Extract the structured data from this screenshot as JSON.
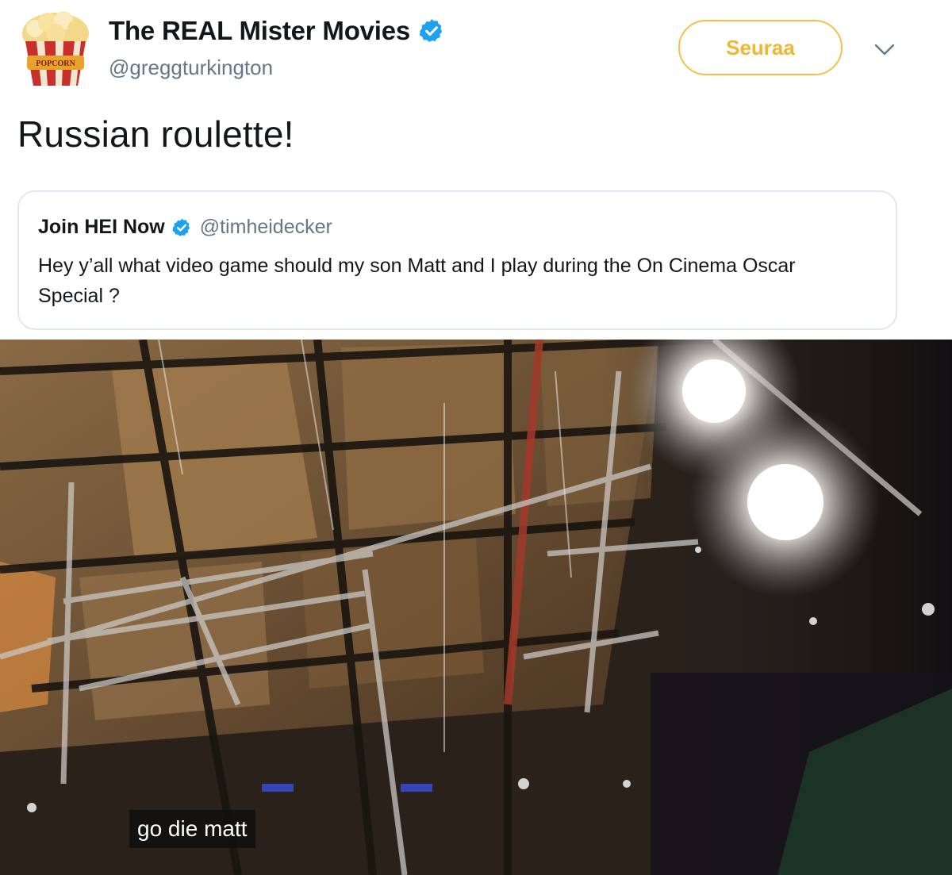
{
  "tweet": {
    "display_name": "The REAL Mister Movies",
    "handle": "@greggturkington",
    "follow_label": "Seuraa",
    "text": "Russian roulette!",
    "avatar_text": "POPCORN"
  },
  "quoted_tweet": {
    "display_name": "Join HEI Now",
    "handle": "@timheidecker",
    "text": "Hey y’all what video game should my son Matt and I play during the On Cinema Oscar Special ?"
  },
  "video": {
    "caption": "go die matt"
  },
  "colors": {
    "verified": "#1da1f2",
    "follow_accent": "#f2b534",
    "quote_border": "#e1e8ed",
    "handle_gray": "#657786"
  },
  "icons": {
    "verified": "verified-badge-icon",
    "caret": "chevron-down-icon"
  }
}
